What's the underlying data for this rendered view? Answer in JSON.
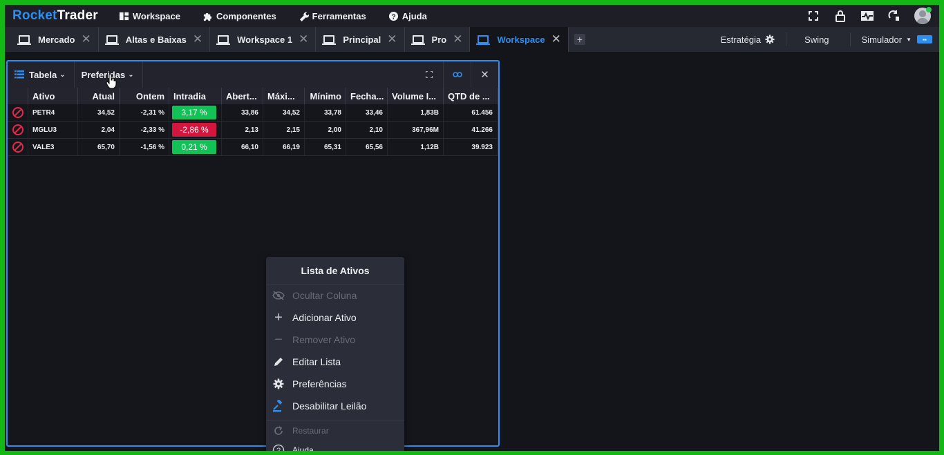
{
  "app": {
    "logo_part1": "Rocket",
    "logo_part2": "Trader"
  },
  "menu": [
    {
      "label": "Workspace",
      "icon": "layout-icon"
    },
    {
      "label": "Componentes",
      "icon": "puzzle-icon"
    },
    {
      "label": "Ferramentas",
      "icon": "wrench-icon"
    },
    {
      "label": "Ajuda",
      "icon": "help-icon"
    }
  ],
  "tabs": [
    {
      "label": "Mercado",
      "active": false
    },
    {
      "label": "Altas e Baixas",
      "active": false
    },
    {
      "label": "Workspace 1",
      "active": false
    },
    {
      "label": "Principal",
      "active": false
    },
    {
      "label": "Pro",
      "active": false
    },
    {
      "label": "Workspace",
      "active": true
    }
  ],
  "tabbar_right": {
    "strategy": "Estratégia",
    "swing": "Swing",
    "simulator": "Simulador"
  },
  "panel": {
    "view_label": "Tabela",
    "preferences_label": "Preferidas"
  },
  "table": {
    "columns": [
      "Ativo",
      "Atual",
      "Ontem",
      "Intradia",
      "Abert...",
      "Máxi...",
      "Mínimo",
      "Fecha...",
      "Volume I...",
      "QTD de ..."
    ],
    "rows": [
      {
        "ativo": "PETR4",
        "atual": "34,52",
        "ontem": "-2,31 %",
        "intradia": "3,17 %",
        "dir": "up",
        "abert": "33,86",
        "max": "34,52",
        "min": "33,78",
        "fech": "33,46",
        "volume": "1,83B",
        "qtd": "61.456"
      },
      {
        "ativo": "MGLU3",
        "atual": "2,04",
        "ontem": "-2,33 %",
        "intradia": "-2,86 %",
        "dir": "down",
        "abert": "2,13",
        "max": "2,15",
        "min": "2,00",
        "fech": "2,10",
        "volume": "367,96M",
        "qtd": "41.266"
      },
      {
        "ativo": "VALE3",
        "atual": "65,70",
        "ontem": "-1,56 %",
        "intradia": "0,21 %",
        "dir": "up",
        "abert": "66,10",
        "max": "66,19",
        "min": "65,31",
        "fech": "65,56",
        "volume": "1,12B",
        "qtd": "39.923"
      }
    ]
  },
  "context_menu": {
    "title": "Lista de Ativos",
    "items": [
      {
        "label": "Ocultar Coluna",
        "icon": "eye-slash-icon",
        "disabled": true
      },
      {
        "label": "Adicionar Ativo",
        "icon": "plus-icon",
        "disabled": false
      },
      {
        "label": "Remover Ativo",
        "icon": "minus-icon",
        "disabled": true
      },
      {
        "label": "Editar Lista",
        "icon": "pencil-icon",
        "disabled": false
      },
      {
        "label": "Preferências",
        "icon": "gear-icon",
        "disabled": false
      },
      {
        "label": "Desabilitar Leilão",
        "icon": "gavel-icon",
        "disabled": false
      }
    ],
    "footer_items": [
      {
        "label": "Restaurar",
        "icon": "restore-icon",
        "disabled": true
      },
      {
        "label": "Ajuda",
        "icon": "question-circle-icon",
        "disabled": false
      }
    ]
  },
  "colors": {
    "accent": "#2e8ff0",
    "up": "#12c257",
    "down": "#d3163e",
    "frame": "#14b814"
  }
}
